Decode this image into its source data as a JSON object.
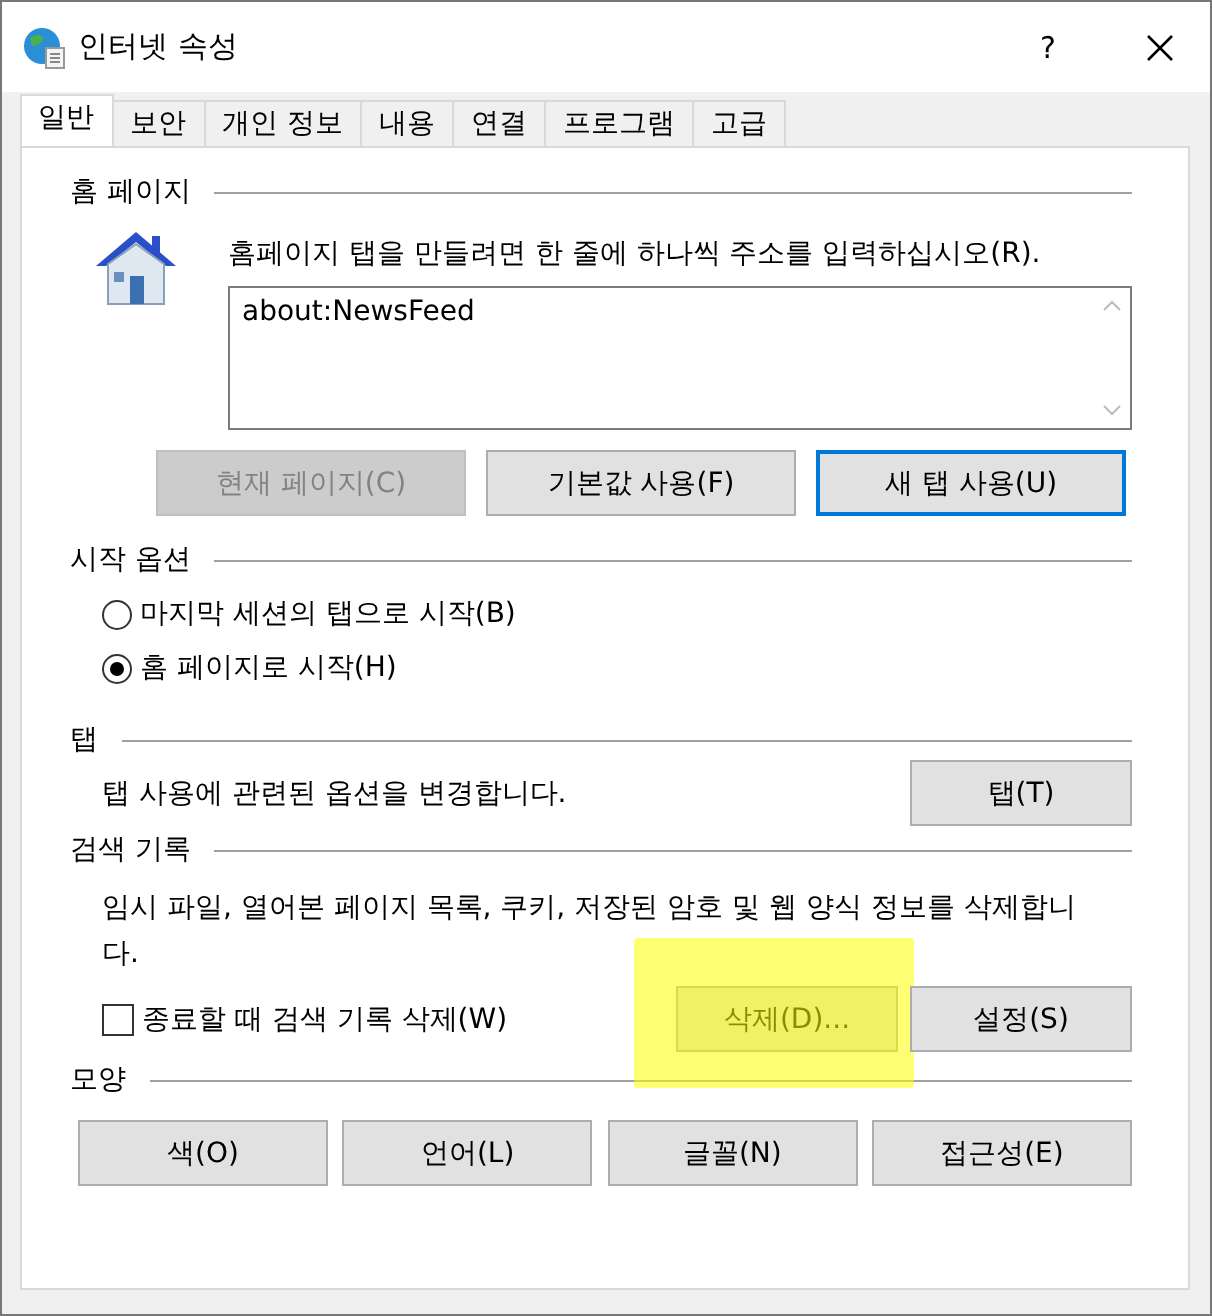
{
  "window": {
    "title": "인터넷 속성",
    "help": "?"
  },
  "tabs": [
    {
      "label": "일반",
      "selected": true
    },
    {
      "label": "보안",
      "selected": false
    },
    {
      "label": "개인 정보",
      "selected": false
    },
    {
      "label": "내용",
      "selected": false
    },
    {
      "label": "연결",
      "selected": false
    },
    {
      "label": "프로그램",
      "selected": false
    },
    {
      "label": "고급",
      "selected": false
    }
  ],
  "home_page": {
    "title": "홈 페이지",
    "instruction": "홈페이지 탭을 만들려면 한 줄에 하나씩 주소를 입력하십시오(R).",
    "value": "about:NewsFeed",
    "buttons": [
      {
        "label": "현재 페이지(C)",
        "disabled": true,
        "focused": false
      },
      {
        "label": "기본값 사용(F)",
        "disabled": false,
        "focused": false
      },
      {
        "label": "새 탭 사용(U)",
        "disabled": false,
        "focused": true
      }
    ]
  },
  "startup": {
    "title": "시작 옵션",
    "options": [
      {
        "label": "마지막 세션의 탭으로 시작(B)",
        "selected": false
      },
      {
        "label": "홈 페이지로 시작(H)",
        "selected": true
      }
    ]
  },
  "tabs_section": {
    "title": "탭",
    "description": "탭 사용에 관련된 옵션을 변경합니다.",
    "button": "탭(T)"
  },
  "history": {
    "title": "검색 기록",
    "description": "임시 파일, 열어본 페이지 목록, 쿠키, 저장된 암호 및 웹 양식 정보를 삭제합니다.",
    "checkbox": {
      "label": "종료할 때 검색 기록 삭제(W)",
      "checked": false
    },
    "buttons": [
      {
        "label": "삭제(D)...",
        "highlighted": true
      },
      {
        "label": "설정(S)",
        "highlighted": false
      }
    ]
  },
  "appearance": {
    "title": "모양",
    "buttons": [
      "색(O)",
      "언어(L)",
      "글꼴(N)",
      "접근성(E)"
    ]
  }
}
